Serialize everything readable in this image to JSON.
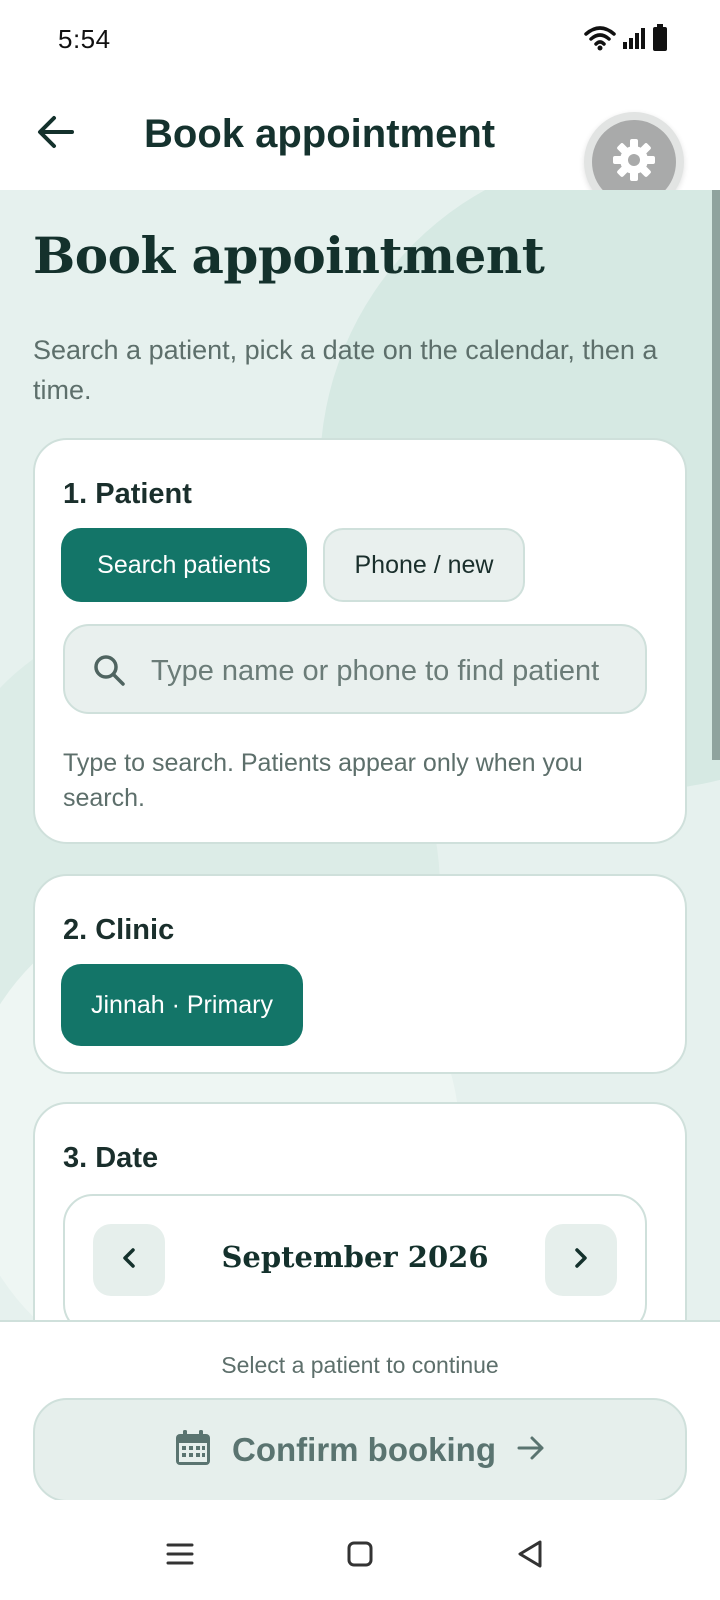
{
  "status_bar": {
    "time": "5:54",
    "icons": [
      "wifi-icon",
      "signal-icon",
      "battery-icon"
    ]
  },
  "app_bar": {
    "title": "Book appointment",
    "back_icon": "back-arrow-icon",
    "settings_icon": "gear-icon"
  },
  "page": {
    "heading": "Book appointment",
    "subtitle": "Search a patient, pick a date on the calendar, then a time."
  },
  "patient_card": {
    "title": "1. Patient",
    "tabs": [
      {
        "label": "Search patients",
        "active": true
      },
      {
        "label": "Phone / new",
        "active": false
      }
    ],
    "search": {
      "placeholder": "Type name or phone to find patient",
      "value": ""
    },
    "hint": "Type to search. Patients appear only when you search."
  },
  "clinic_card": {
    "title": "2. Clinic",
    "selected": "Jinnah · Primary"
  },
  "date_card": {
    "title": "3. Date",
    "month": "September 2026"
  },
  "footer": {
    "hint": "Select a patient to continue",
    "confirm_label": "Confirm booking",
    "confirm_icon": "calendar-icon",
    "arrow_icon": "arrow-right-icon"
  },
  "colors": {
    "primary": "#137568",
    "background": "#e6f1ee",
    "text": "#14312c"
  }
}
